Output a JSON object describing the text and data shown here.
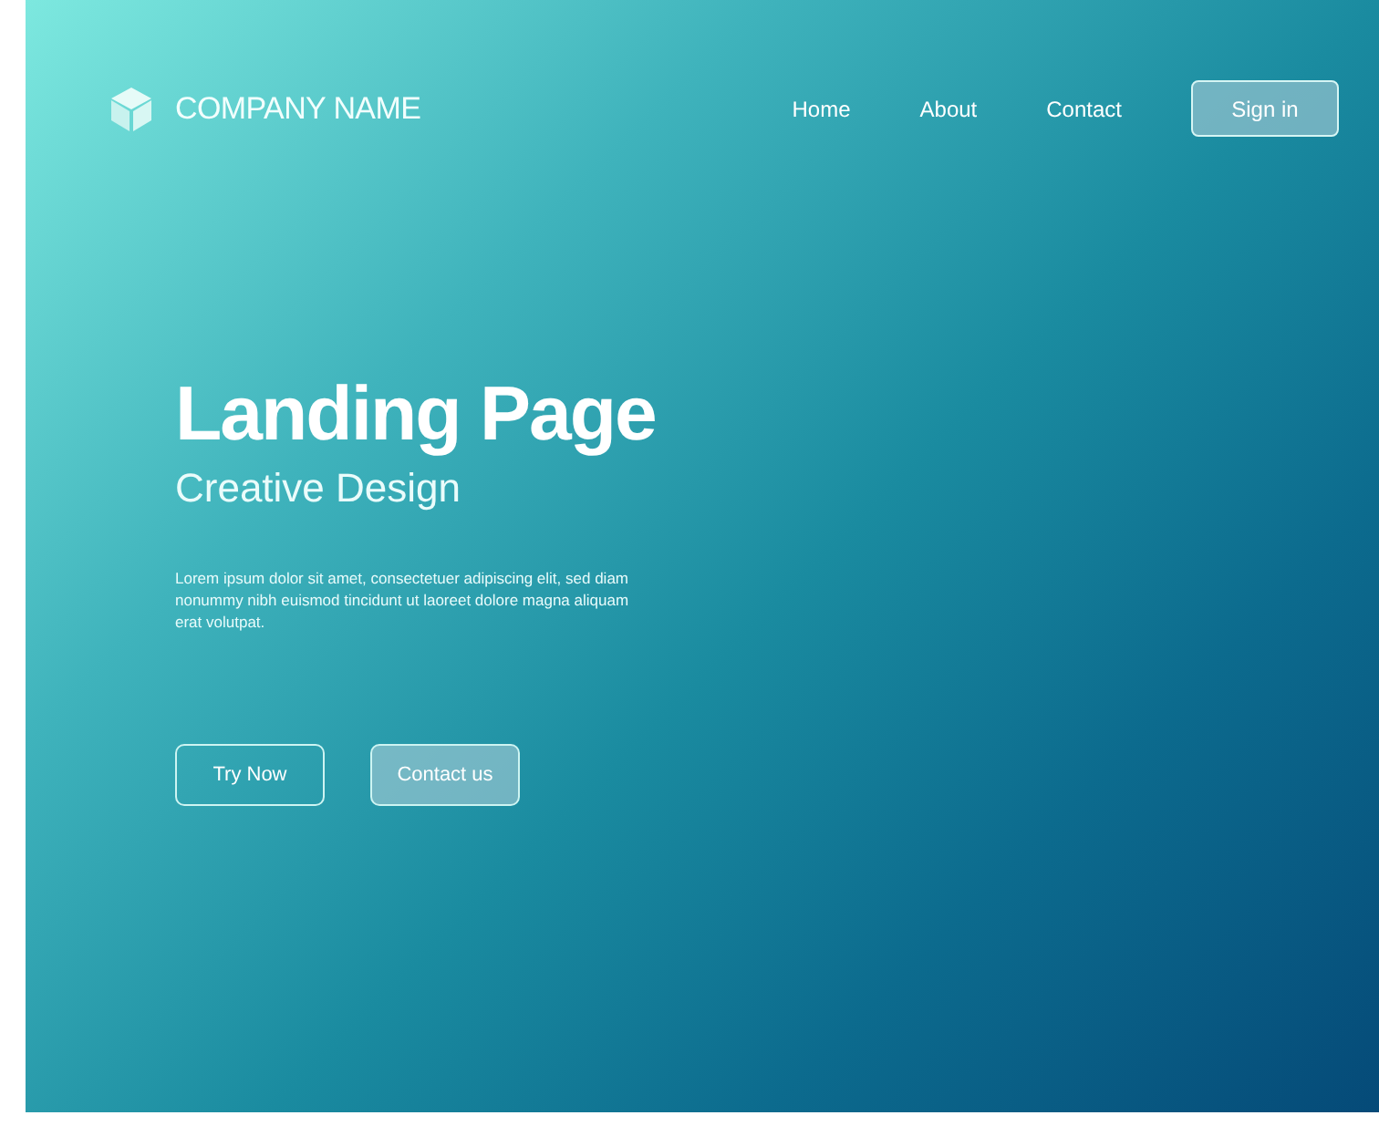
{
  "brand": {
    "name": "COMPANY NAME"
  },
  "nav": {
    "links": [
      "Home",
      "About",
      "Contact"
    ],
    "sign_in": "Sign in"
  },
  "hero": {
    "title": "Landing Page",
    "subtitle": "Creative Design",
    "text": "Lorem ipsum dolor sit amet, consectetuer adipiscing elit, sed diam nonummy nibh euismod tincidunt ut laoreet dolore magna aliquam erat volutpat.",
    "buttons": [
      {
        "label": "Try Now",
        "kind": "outline"
      },
      {
        "label": "Contact us",
        "kind": "filled"
      }
    ]
  }
}
